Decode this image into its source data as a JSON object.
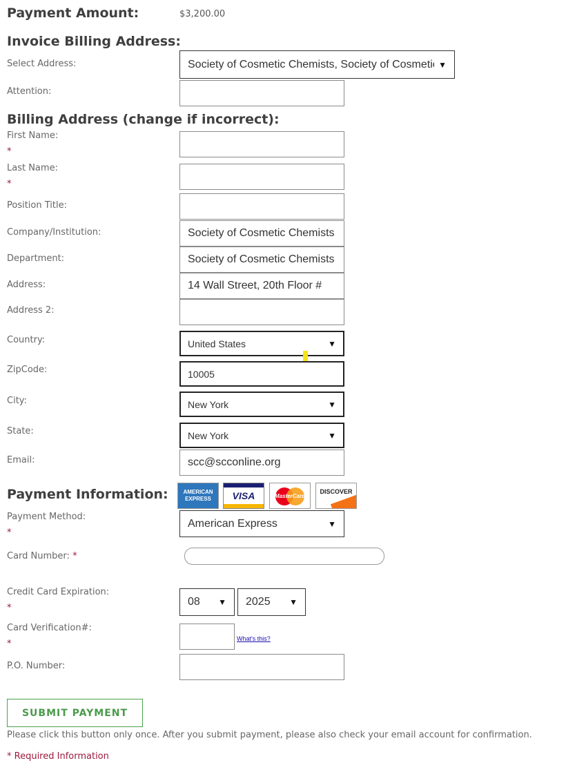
{
  "payment_amount": {
    "label": "Payment Amount:",
    "value": "$3,200.00"
  },
  "invoice": {
    "heading": "Invoice Billing Address:",
    "select_label": "Select Address:",
    "select_value": "Society of Cosmetic Chemists, Society of Cosmetic",
    "attention_label": "Attention:",
    "attention_value": ""
  },
  "billing": {
    "heading": "Billing Address (change if incorrect):",
    "first_name_label": "First Name:",
    "last_name_label": "Last Name:",
    "position_label": "Position Title:",
    "company_label": "Company/Institution:",
    "company_value": "Society of Cosmetic Chemists",
    "department_label": "Department:",
    "department_value": "Society of Cosmetic Chemists",
    "address_label": "Address:",
    "address_value": "14 Wall Street, 20th Floor #",
    "address2_label": "Address 2:",
    "country_label": "Country:",
    "country_value": "United States",
    "zip_label": "ZipCode:",
    "zip_value": "10005",
    "city_label": "City:",
    "city_value": "New York",
    "state_label": "State:",
    "state_value": "New York",
    "email_label": "Email:",
    "email_value": "scc@scconline.org"
  },
  "payment": {
    "heading": "Payment Information:",
    "cards": {
      "amex": "AMERICAN EXPRESS",
      "visa": "VISA",
      "mastercard": "MasterCard",
      "discover": "DISCOVER"
    },
    "method_label": "Payment Method:",
    "method_value": "American Express",
    "card_number_label": "Card Number:",
    "expiration_label": "Credit Card Expiration:",
    "exp_month": "08",
    "exp_year": "2025",
    "cvv_label": "Card Verification#:",
    "whats_this": "What's this?",
    "po_label": "P.O. Number:"
  },
  "required_star": "*",
  "submit_label": "SUBMIT PAYMENT",
  "submit_note": "Please click this button only once. After you submit payment, please also check your email account for confirmation.",
  "required_info": "* Required Information",
  "colors": {
    "accent_green": "#4a9a4a",
    "required_red": "#9c1a3c",
    "link_blue": "#1a0dab",
    "highlight_yellow": "#f5e41b"
  }
}
